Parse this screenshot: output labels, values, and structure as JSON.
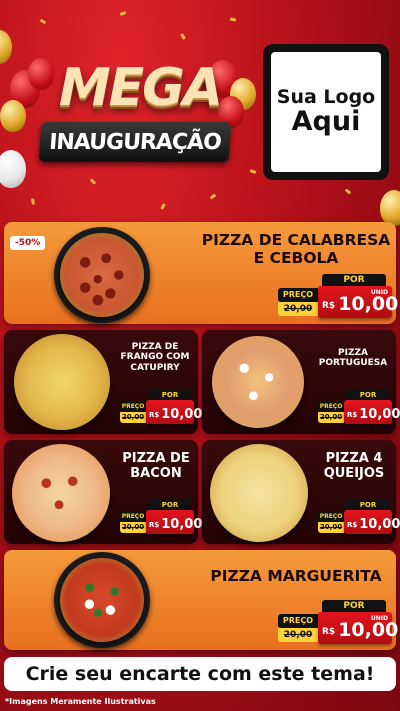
{
  "header": {
    "title_line1": "MEGA",
    "title_line2": "INAUGURAÇÃO",
    "logo_line1": "Sua Logo",
    "logo_line2": "Aqui"
  },
  "featured_badge": "-50%",
  "products": [
    {
      "name_line1": "PIZZA DE CALABRESA",
      "name_line2": "E CEBOLA",
      "por": "POR",
      "preco": "PREÇO",
      "old_price": "20,00",
      "currency": "R$",
      "price": "10,00",
      "unit": "UNID"
    },
    {
      "name_line1": "PIZZA DE",
      "name_line2": "FRANGO COM",
      "name_line3": "CATUPIRY",
      "por": "POR",
      "preco": "PREÇO",
      "old_price": "20,00",
      "currency": "R$",
      "price": "10,00"
    },
    {
      "name_line1": "PIZZA",
      "name_line2": "PORTUGUESA",
      "por": "POR",
      "preco": "PREÇO",
      "old_price": "20,00",
      "currency": "R$",
      "price": "10,00"
    },
    {
      "name_line1": "PIZZA DE",
      "name_line2": "BACON",
      "por": "POR",
      "preco": "PREÇO",
      "old_price": "20,00",
      "currency": "R$",
      "price": "10,00"
    },
    {
      "name_line1": "PIZZA 4",
      "name_line2": "QUEIJOS",
      "por": "POR",
      "preco": "PREÇO",
      "old_price": "20,00",
      "currency": "R$",
      "price": "10,00"
    },
    {
      "name_line1": "PIZZA MARGUERITA",
      "por": "POR",
      "preco": "PREÇO",
      "old_price": "20,00",
      "currency": "R$",
      "price": "10,00",
      "unit": "UNID"
    }
  ],
  "footer_text": "Crie seu encarte com este tema!",
  "disclaimer": "*Imagens Meramente Ilustrativas"
}
